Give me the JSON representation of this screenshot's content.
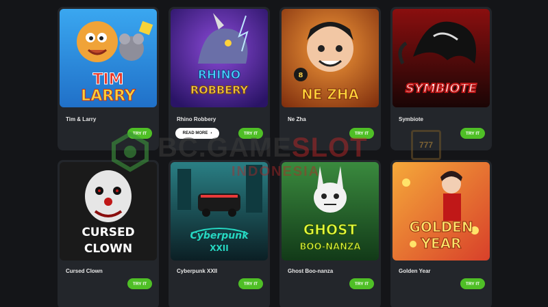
{
  "games": [
    {
      "title": "Tim & Larry",
      "art": "TIM & LARRY",
      "try_label": "TRY IT",
      "bg1": "#2d8de0",
      "bg2": "#f0c23a",
      "accent": "#e8392a"
    },
    {
      "title": "Rhino Robbery",
      "art": "RHINO ROBBERY",
      "try_label": "TRY IT",
      "more_label": "READ MORE",
      "bg1": "#6a2fb8",
      "bg2": "#2a1466",
      "accent": "#f2c744"
    },
    {
      "title": "Ne Zha",
      "art": "NE ZHA",
      "try_label": "TRY IT",
      "bg1": "#e06a1a",
      "bg2": "#7a2a0c",
      "accent": "#ffd23a"
    },
    {
      "title": "Symbiote",
      "art": "SYMBIOTE",
      "try_label": "TRY IT",
      "bg1": "#b01818",
      "bg2": "#1a1a1a",
      "accent": "#ffffff"
    },
    {
      "title": "Cursed Clown",
      "art": "CURSED CLOWN",
      "try_label": "TRY IT",
      "bg1": "#3a3a3a",
      "bg2": "#0e0e0e",
      "accent": "#ffffff"
    },
    {
      "title": "Cyberpunk XXII",
      "art": "Cyberpunk XXII",
      "try_label": "TRY IT",
      "bg1": "#1d6f74",
      "bg2": "#0b1f24",
      "accent": "#26d8c2"
    },
    {
      "title": "Ghost Boo-nanza",
      "art": "GHOST BOO-NANZA",
      "try_label": "TRY IT",
      "bg1": "#2f7a34",
      "bg2": "#123a18",
      "accent": "#e6ff3a"
    },
    {
      "title": "Golden Year",
      "art": "GOLDEN YEAR",
      "try_label": "TRY IT",
      "bg1": "#e8532a",
      "bg2": "#f2c43a",
      "accent": "#ffe36a"
    }
  ],
  "watermark": {
    "brand": "BC.GAME",
    "brand_accent": "SLOT",
    "sub": "INDONESIA",
    "badge": "777"
  },
  "colors": {
    "try_button": "#4fbf26",
    "card_bg": "#23262b",
    "page_bg": "#141518"
  }
}
